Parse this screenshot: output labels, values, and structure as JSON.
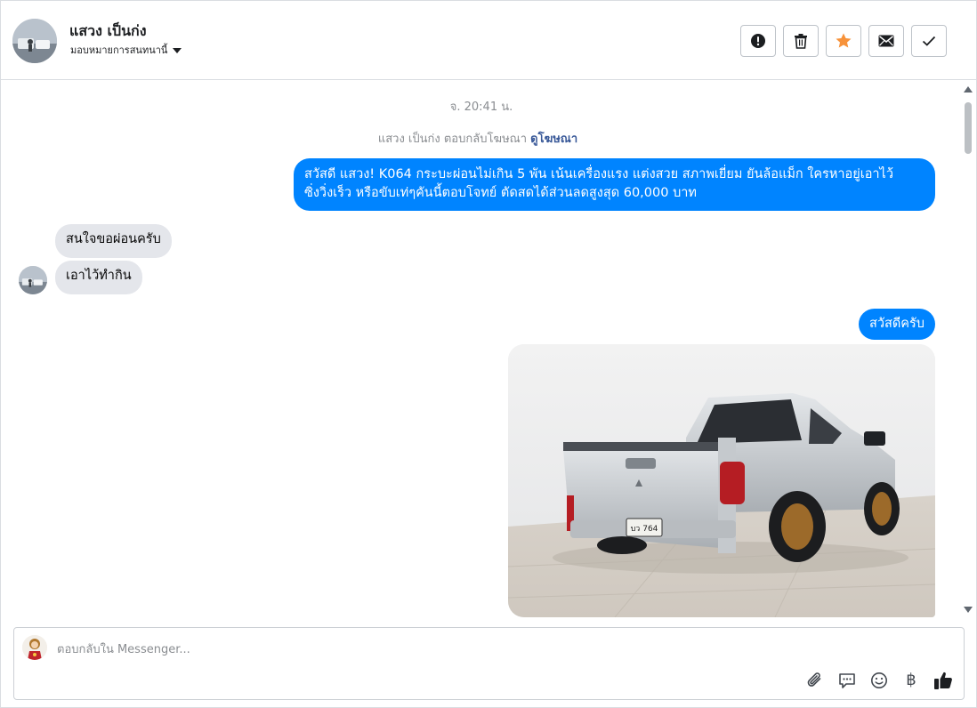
{
  "header": {
    "contact_name": "แสวง เป็นก่ง",
    "assign_label": "มอบหมายการสนทนานี้",
    "actions": [
      {
        "name": "mark-spam-button",
        "icon": "alert-icon"
      },
      {
        "name": "delete-button",
        "icon": "trash-icon"
      },
      {
        "name": "star-button",
        "icon": "star-icon"
      },
      {
        "name": "mark-unread-button",
        "icon": "envelope-icon"
      },
      {
        "name": "mark-done-button",
        "icon": "check-icon"
      }
    ]
  },
  "thread": {
    "timestamp": "จ. 20:41 น.",
    "ad_reply_text": "แสวง เป็นก่ง ตอบกลับโฆษณา",
    "ad_reply_link": "ดูโฆษณา",
    "messages": [
      {
        "direction": "outgoing",
        "line1": "สวัสดี แสวง! K064 กระบะผ่อนไม่เกิน 5 พัน เน้นเครื่องแรง แต่งสวย สภาพเยี่ยม ยันล้อแม็ก ใครหาอยู่เอาไว้",
        "line2": "ซิ่งวิ่งเร็ว หรือขับเท่ๆคันนี้ตอบโจทย์ ตัดสดได้ส่วนลดสูงสุด 60,000 บาท"
      },
      {
        "direction": "incoming",
        "text": "สนใจขอผ่อนครับ"
      },
      {
        "direction": "incoming",
        "text": "เอาไว้ทำกิน"
      },
      {
        "direction": "outgoing",
        "text": "สวัสดีครับ"
      },
      {
        "direction": "outgoing",
        "type": "photo",
        "plate_text": "บว 764"
      }
    ]
  },
  "composer": {
    "placeholder": "ตอบกลับใน Messenger...",
    "tools": [
      "attachment-icon",
      "saved-reply-icon",
      "emoji-icon",
      "payment-baht-icon",
      "like-icon"
    ],
    "baht_symbol": "฿"
  },
  "colors": {
    "accent_blue": "#0084ff",
    "incoming_bubble": "#e4e6eb",
    "star_orange": "#f7923a",
    "link_blue": "#385898"
  }
}
